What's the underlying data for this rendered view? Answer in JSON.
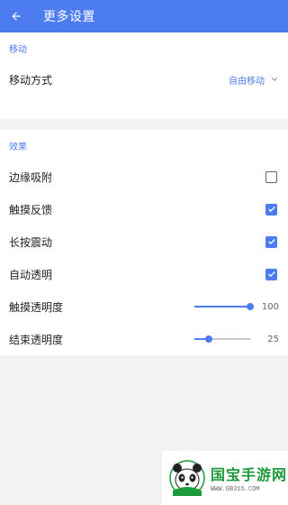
{
  "toolbar": {
    "title": "更多设置",
    "back_icon": "arrow-left-icon",
    "background": "#4c7cf0"
  },
  "sections": {
    "move": {
      "header": "移动",
      "mode_label": "移动方式",
      "mode_value": "自由移动",
      "chevron_icon": "chevron-down-icon"
    },
    "effect": {
      "header": "效果",
      "edge_snap": {
        "label": "边缘吸附",
        "checked": false
      },
      "haptic": {
        "label": "触摸反馈",
        "checked": true
      },
      "long_press_vibrate": {
        "label": "长按震动",
        "checked": true
      },
      "auto_transparent": {
        "label": "自动透明",
        "checked": true
      },
      "touch_opacity": {
        "label": "触摸透明度",
        "value": "100",
        "fraction": 1.0
      },
      "end_opacity": {
        "label": "结束透明度",
        "value": "25",
        "fraction": 0.25
      }
    }
  },
  "watermark": {
    "brand": "国宝手游网",
    "site": "WWW.GB315.COM",
    "logo_icon": "panda-icon"
  },
  "colors": {
    "accent": "#4c7cf0",
    "checkbox_border": "#666666",
    "brand_green": "#1d9b3a"
  }
}
